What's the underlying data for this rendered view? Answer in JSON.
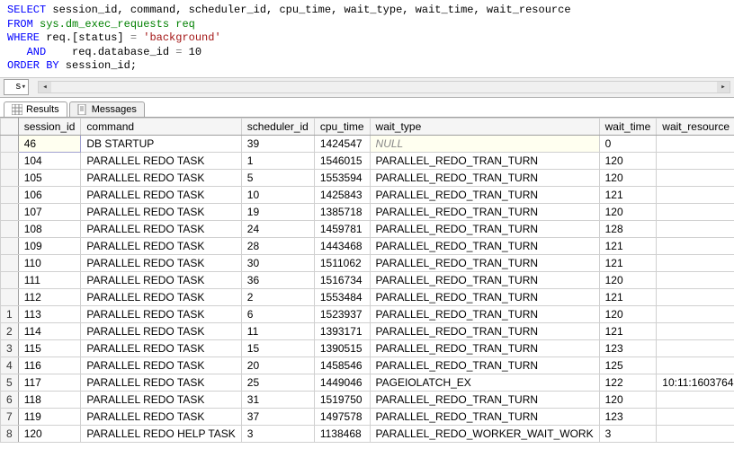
{
  "sql": {
    "line1": {
      "kw_select": "SELECT",
      "cols": " session_id, command, scheduler_id, cpu_time, wait_type, wait_time, wait_resource"
    },
    "line2": {
      "kw_from": "FROM",
      "obj": " sys.dm_exec_requests req"
    },
    "line3": {
      "kw_where": "WHERE",
      "cond": " req.[status] ",
      "op": "=",
      "val": " 'background'"
    },
    "line4": {
      "kw_and": "   AND",
      "cond": "    req.database_id ",
      "op": "=",
      "val": " 10"
    },
    "line5": {
      "kw_order": "ORDER BY",
      "col": " session_id;"
    }
  },
  "combo": {
    "value": "s"
  },
  "tabs": {
    "results": "Results",
    "messages": "Messages"
  },
  "grid": {
    "headers": [
      "session_id",
      "command",
      "scheduler_id",
      "cpu_time",
      "wait_type",
      "wait_time",
      "wait_resource"
    ],
    "rows": [
      {
        "n": "",
        "session_id": "46",
        "command": "DB STARTUP",
        "scheduler_id": "39",
        "cpu_time": "1424547",
        "wait_type": "NULL",
        "wait_time": "0",
        "wait_resource": ""
      },
      {
        "n": "",
        "session_id": "104",
        "command": "PARALLEL REDO TASK",
        "scheduler_id": "1",
        "cpu_time": "1546015",
        "wait_type": "PARALLEL_REDO_TRAN_TURN",
        "wait_time": "120",
        "wait_resource": ""
      },
      {
        "n": "",
        "session_id": "105",
        "command": "PARALLEL REDO TASK",
        "scheduler_id": "5",
        "cpu_time": "1553594",
        "wait_type": "PARALLEL_REDO_TRAN_TURN",
        "wait_time": "120",
        "wait_resource": ""
      },
      {
        "n": "",
        "session_id": "106",
        "command": "PARALLEL REDO TASK",
        "scheduler_id": "10",
        "cpu_time": "1425843",
        "wait_type": "PARALLEL_REDO_TRAN_TURN",
        "wait_time": "121",
        "wait_resource": ""
      },
      {
        "n": "",
        "session_id": "107",
        "command": "PARALLEL REDO TASK",
        "scheduler_id": "19",
        "cpu_time": "1385718",
        "wait_type": "PARALLEL_REDO_TRAN_TURN",
        "wait_time": "120",
        "wait_resource": ""
      },
      {
        "n": "",
        "session_id": "108",
        "command": "PARALLEL REDO TASK",
        "scheduler_id": "24",
        "cpu_time": "1459781",
        "wait_type": "PARALLEL_REDO_TRAN_TURN",
        "wait_time": "128",
        "wait_resource": ""
      },
      {
        "n": "",
        "session_id": "109",
        "command": "PARALLEL REDO TASK",
        "scheduler_id": "28",
        "cpu_time": "1443468",
        "wait_type": "PARALLEL_REDO_TRAN_TURN",
        "wait_time": "121",
        "wait_resource": ""
      },
      {
        "n": "",
        "session_id": "110",
        "command": "PARALLEL REDO TASK",
        "scheduler_id": "30",
        "cpu_time": "1511062",
        "wait_type": "PARALLEL_REDO_TRAN_TURN",
        "wait_time": "121",
        "wait_resource": ""
      },
      {
        "n": "",
        "session_id": "111",
        "command": "PARALLEL REDO TASK",
        "scheduler_id": "36",
        "cpu_time": "1516734",
        "wait_type": "PARALLEL_REDO_TRAN_TURN",
        "wait_time": "120",
        "wait_resource": ""
      },
      {
        "n": "",
        "session_id": "112",
        "command": "PARALLEL REDO TASK",
        "scheduler_id": "2",
        "cpu_time": "1553484",
        "wait_type": "PARALLEL_REDO_TRAN_TURN",
        "wait_time": "121",
        "wait_resource": ""
      },
      {
        "n": "1",
        "session_id": "113",
        "command": "PARALLEL REDO TASK",
        "scheduler_id": "6",
        "cpu_time": "1523937",
        "wait_type": "PARALLEL_REDO_TRAN_TURN",
        "wait_time": "120",
        "wait_resource": ""
      },
      {
        "n": "2",
        "session_id": "114",
        "command": "PARALLEL REDO TASK",
        "scheduler_id": "11",
        "cpu_time": "1393171",
        "wait_type": "PARALLEL_REDO_TRAN_TURN",
        "wait_time": "121",
        "wait_resource": ""
      },
      {
        "n": "3",
        "session_id": "115",
        "command": "PARALLEL REDO TASK",
        "scheduler_id": "15",
        "cpu_time": "1390515",
        "wait_type": "PARALLEL_REDO_TRAN_TURN",
        "wait_time": "123",
        "wait_resource": ""
      },
      {
        "n": "4",
        "session_id": "116",
        "command": "PARALLEL REDO TASK",
        "scheduler_id": "20",
        "cpu_time": "1458546",
        "wait_type": "PARALLEL_REDO_TRAN_TURN",
        "wait_time": "125",
        "wait_resource": ""
      },
      {
        "n": "5",
        "session_id": "117",
        "command": "PARALLEL REDO TASK",
        "scheduler_id": "25",
        "cpu_time": "1449046",
        "wait_type": "PAGEIOLATCH_EX",
        "wait_time": "122",
        "wait_resource": "10:11:1603764"
      },
      {
        "n": "6",
        "session_id": "118",
        "command": "PARALLEL REDO TASK",
        "scheduler_id": "31",
        "cpu_time": "1519750",
        "wait_type": "PARALLEL_REDO_TRAN_TURN",
        "wait_time": "120",
        "wait_resource": ""
      },
      {
        "n": "7",
        "session_id": "119",
        "command": "PARALLEL REDO TASK",
        "scheduler_id": "37",
        "cpu_time": "1497578",
        "wait_type": "PARALLEL_REDO_TRAN_TURN",
        "wait_time": "123",
        "wait_resource": ""
      },
      {
        "n": "8",
        "session_id": "120",
        "command": "PARALLEL REDO HELP TASK",
        "scheduler_id": "3",
        "cpu_time": "1138468",
        "wait_type": "PARALLEL_REDO_WORKER_WAIT_WORK",
        "wait_time": "3",
        "wait_resource": ""
      }
    ]
  }
}
